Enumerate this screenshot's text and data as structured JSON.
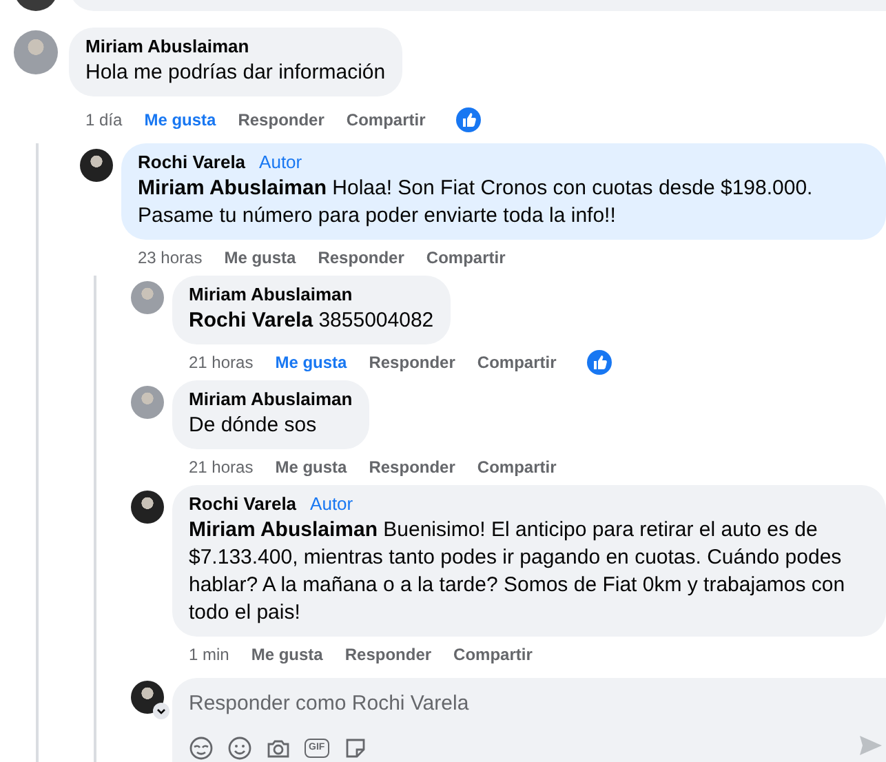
{
  "comments": [
    {
      "author": "Miriam Abuslaiman",
      "text": "Hola me podrías dar información",
      "highlighted": false,
      "time": "1 día",
      "like_label": "Me gusta",
      "liked": true,
      "reply_label": "Responder",
      "share_label": "Compartir",
      "reacted": true,
      "children": [
        {
          "author": "Rochi Varela",
          "badge": "Autor",
          "text": "**Miriam Abuslaiman** Holaa! Son Fiat Cronos con cuotas desde $198.000. Pasame tu número para poder enviarte toda la info!!",
          "highlighted": true,
          "time": "23 horas",
          "like_label": "Me gusta",
          "liked": false,
          "reply_label": "Responder",
          "share_label": "Compartir",
          "reacted": false,
          "children": [
            {
              "author": "Miriam Abuslaiman",
              "text": "**Rochi Varela** 3855004082",
              "highlighted": false,
              "time": "21 horas",
              "like_label": "Me gusta",
              "liked": true,
              "reply_label": "Responder",
              "share_label": "Compartir",
              "reacted": true
            },
            {
              "author": "Miriam Abuslaiman",
              "text": "De dónde sos",
              "highlighted": false,
              "time": "21 horas",
              "like_label": "Me gusta",
              "liked": false,
              "reply_label": "Responder",
              "share_label": "Compartir",
              "reacted": false
            },
            {
              "author": "Rochi Varela",
              "badge": "Autor",
              "text": "**Miriam Abuslaiman** Buenisimo! El anticipo para retirar el auto es de $7.133.400, mientras tanto podes ir pagando en cuotas. Cuándo podes hablar? A la mañana o a la tarde? Somos de Fiat 0km y trabajamos con todo el pais!",
              "highlighted": false,
              "time": "1 min",
              "like_label": "Me gusta",
              "liked": false,
              "reply_label": "Responder",
              "share_label": "Compartir",
              "reacted": false
            }
          ],
          "reply_box": {
            "placeholder": "Responder como Rochi Varela",
            "gif_label": "GIF"
          }
        }
      ]
    }
  ]
}
